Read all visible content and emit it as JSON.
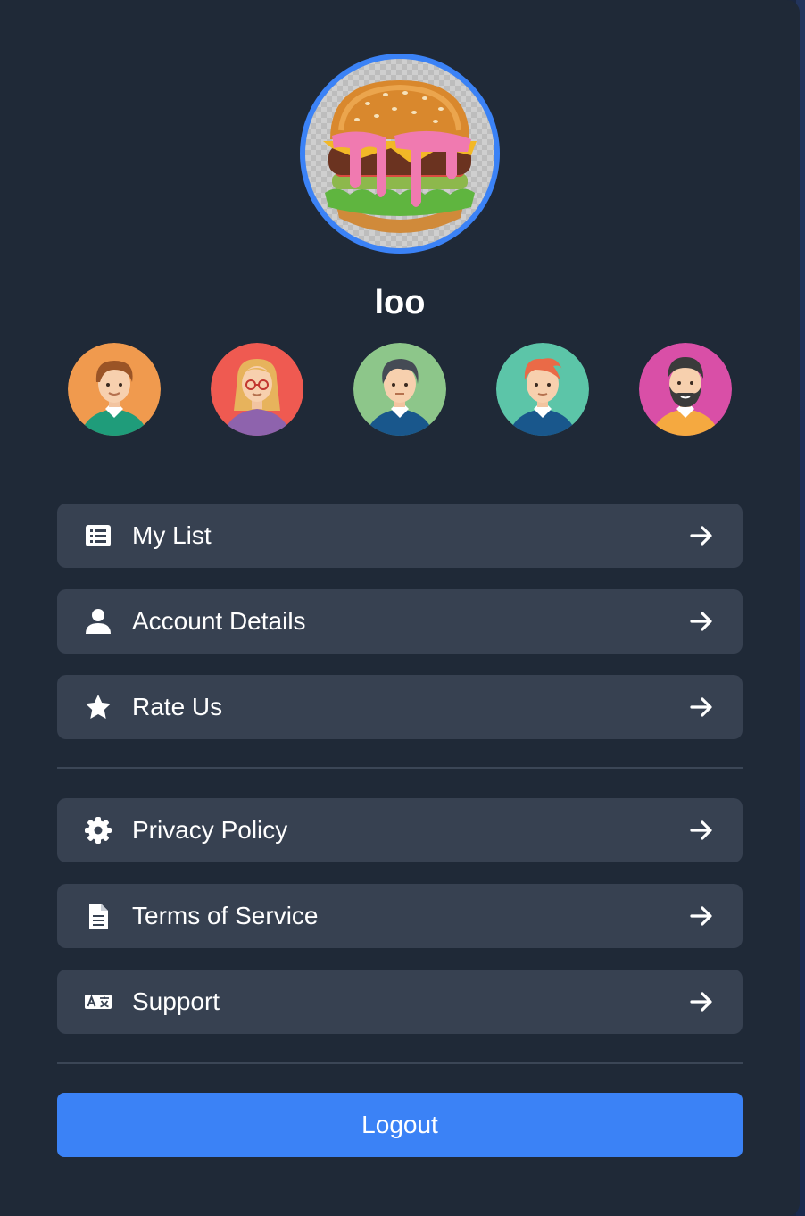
{
  "profile": {
    "username": "loo",
    "avatar": "burger-image",
    "avatar_ring_color": "#3b82f6"
  },
  "avatar_choices": [
    {
      "name": "boy-brown-hair-avatar",
      "bg": "#f09a4e"
    },
    {
      "name": "woman-glasses-avatar",
      "bg": "#ef5a51"
    },
    {
      "name": "man-dark-hair-avatar",
      "bg": "#8dc68a"
    },
    {
      "name": "man-red-hair-avatar",
      "bg": "#5cc5a8"
    },
    {
      "name": "bearded-man-avatar",
      "bg": "#d94fa7"
    }
  ],
  "menu": {
    "primary": [
      {
        "label": "My List",
        "icon": "list-icon"
      },
      {
        "label": "Account Details",
        "icon": "user-icon"
      },
      {
        "label": "Rate Us",
        "icon": "star-icon"
      }
    ],
    "secondary": [
      {
        "label": "Privacy Policy",
        "icon": "gear-icon"
      },
      {
        "label": "Terms of Service",
        "icon": "document-icon"
      },
      {
        "label": "Support",
        "icon": "translate-icon"
      }
    ]
  },
  "logout_label": "Logout",
  "colors": {
    "background": "#1f2937",
    "item_background": "#374151",
    "accent": "#3b82f6"
  }
}
